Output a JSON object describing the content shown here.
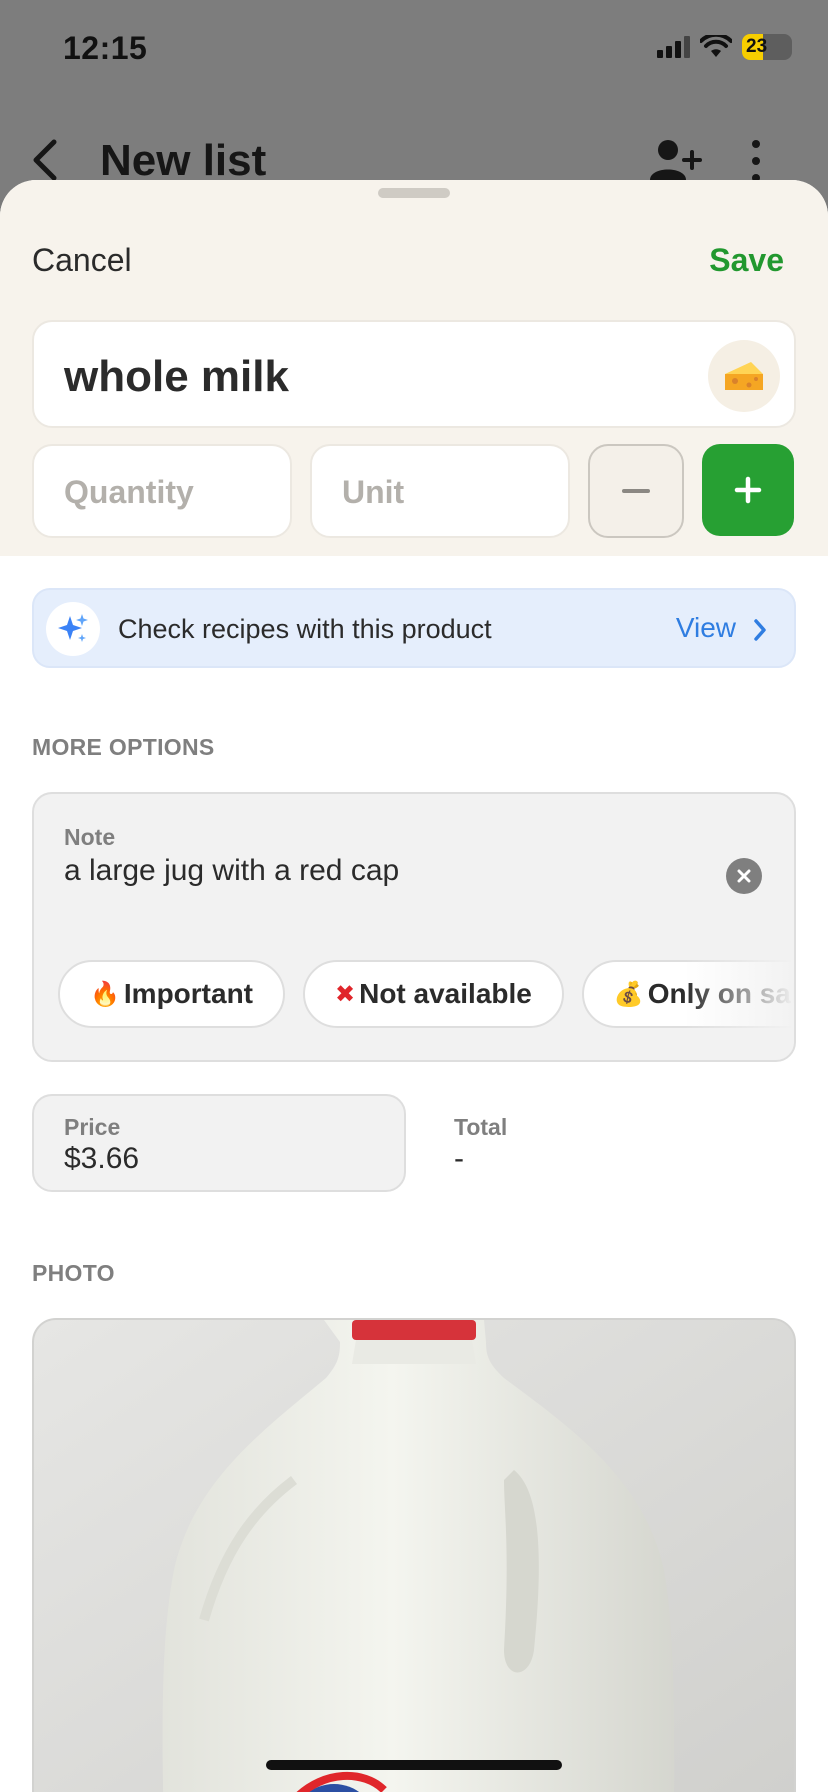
{
  "status_bar": {
    "time": "12:15",
    "battery": "23"
  },
  "background_screen": {
    "title": "New list"
  },
  "sheet": {
    "cancel_label": "Cancel",
    "save_label": "Save",
    "item_name": "whole milk",
    "quantity_placeholder": "Quantity",
    "unit_placeholder": "Unit",
    "recipes_label": "Check recipes with this product",
    "recipes_link": "View",
    "more_options_label": "MORE OPTIONS",
    "note": {
      "caption": "Note",
      "value": "a large jug with a red cap"
    },
    "chips": [
      {
        "emoji": "🔥",
        "label": "Important"
      },
      {
        "emoji": "✖",
        "label": "Not available"
      },
      {
        "emoji": "💰",
        "label": "Only on sale"
      }
    ],
    "price": {
      "caption": "Price",
      "value": "$3.66"
    },
    "total": {
      "caption": "Total",
      "value": "-"
    },
    "photo_label": "PHOTO"
  },
  "colors": {
    "accent_green": "#27a033",
    "link_blue": "#2f7de1",
    "sheet_bg": "#f7f3ec"
  },
  "icons": [
    "back-chevron-icon",
    "add-user-icon",
    "more-vertical-icon",
    "cheese-icon",
    "minus-icon",
    "plus-icon",
    "sparkle-icon",
    "chevron-right-icon",
    "clear-icon"
  ]
}
